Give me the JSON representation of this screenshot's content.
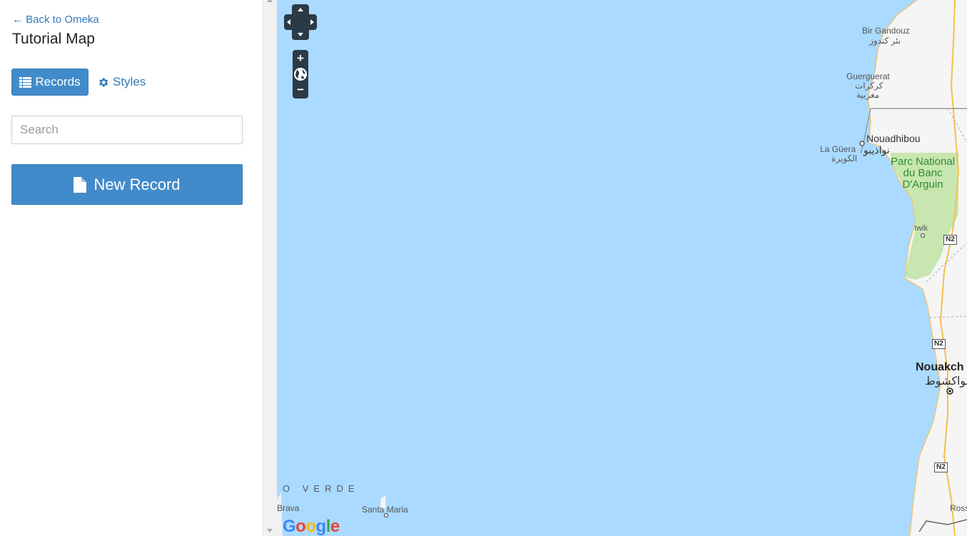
{
  "sidebar": {
    "back_link": "← Back to Omeka",
    "title": "Tutorial Map",
    "records_label": "Records",
    "styles_label": "Styles",
    "search_placeholder": "Search",
    "search_value": "",
    "new_record_label": "New Record"
  },
  "map": {
    "labels": {
      "bir_gandouz": "Bir Gandouz",
      "bir_gandouz_ar": "بئر كندوز",
      "guerguerat": "Guerguerat",
      "guerguerat_ar1": "كركرات",
      "guerguerat_ar2": "مغربية",
      "nouadhibou": "Nouadhibou",
      "nouadhibou_ar": "نواذيبو",
      "la_guera": "La Güera",
      "la_guera_ar": "الكويرة",
      "park": "Parc National\ndu Banc\nD'Arguin",
      "iwik": "Iwik",
      "nouakchott": "Nouakch",
      "nouakchott_ar": "نواكشوط",
      "cabo_verde": "O VERDE",
      "brava": "Brava",
      "santa_maria": "Santa Maria",
      "ross": "Ross",
      "google": "Google"
    },
    "road_shields": [
      "N2",
      "N2",
      "N2"
    ],
    "colors": {
      "water": "#aadaff",
      "land": "#f5f5f5",
      "park": "#c8e6b0",
      "road": "#f5c04a"
    }
  },
  "icons": {
    "records": "list-icon",
    "styles": "gear-icon",
    "new_record": "file-icon",
    "zoom_in": "plus-icon",
    "zoom_out": "minus-icon",
    "globe": "globe-icon"
  }
}
